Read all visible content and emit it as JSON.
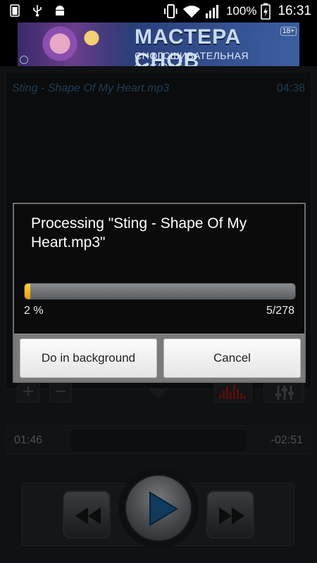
{
  "status_bar": {
    "left_icons": [
      "battery-full-notification-icon",
      "usb-icon",
      "android-debug-icon"
    ],
    "battery_percent": "100%",
    "time": "16:31",
    "right_icons": [
      "vibrate-icon",
      "wifi-icon",
      "signal-icon",
      "battery-charging-icon"
    ]
  },
  "ad_banner": {
    "title": "МАСТЕРА СНОВ",
    "subtitle": "СНОГСШИБАТЕЛЬНАЯ CCG/RPG",
    "age_rating": "18+"
  },
  "player": {
    "track_name": "Sting - Shape Of My Heart.mp3",
    "duration": "04:38",
    "elapsed": "01:46",
    "remaining": "-02:51",
    "controls": [
      "zoom-in-button",
      "zoom-out-button",
      "spectrum-button",
      "equalizer-button"
    ],
    "transport_icons": [
      "rewind-icon",
      "play-icon",
      "fast-forward-icon"
    ]
  },
  "dialog": {
    "message": "Processing \"Sting - Shape Of My Heart.mp3\"",
    "progress_percent_label": "2 %",
    "progress_fraction": 0.02,
    "progress_count": "5/278",
    "background_button": "Do in background",
    "cancel_button": "Cancel"
  },
  "colors": {
    "accent_progress": "#f5b400",
    "track_text": "#3a6e9a",
    "play_icon": "#1d6aa8"
  }
}
